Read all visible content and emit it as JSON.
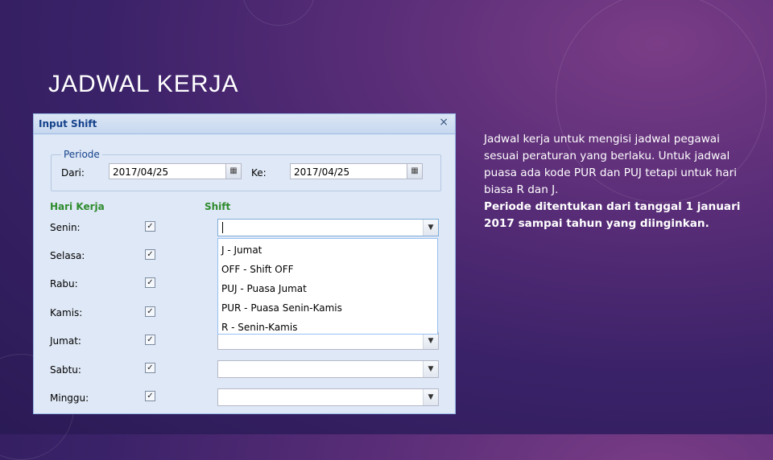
{
  "slide": {
    "title": "JADWAL KERJA",
    "description": "Jadwal kerja untuk mengisi jadwal pegawai sesuai peraturan yang berlaku. Untuk jadwal puasa ada kode PUR dan PUJ tetapi untuk hari biasa R dan J.",
    "note": "Periode ditentukan dari tanggal 1 januari 2017 sampai tahun yang diinginkan."
  },
  "dialog": {
    "title": "Input Shift",
    "close_icon": "×",
    "periode": {
      "legend": "Periode",
      "dari_label": "Dari:",
      "dari_value": "2017/04/25",
      "ke_label": "Ke:",
      "ke_value": "2017/04/25",
      "calendar_icon": "▦"
    },
    "hari_kerja_header": "Hari Kerja",
    "shift_header": "Shift",
    "check_mark": "✓",
    "dropdown_arrow": "▼",
    "days": [
      {
        "label": "Senin:"
      },
      {
        "label": "Selasa:"
      },
      {
        "label": "Rabu:"
      },
      {
        "label": "Kamis:"
      },
      {
        "label": "Jumat:"
      },
      {
        "label": "Sabtu:"
      },
      {
        "label": "Minggu:"
      }
    ],
    "shift_options": [
      "J - Jumat",
      "OFF - Shift OFF",
      "PUJ - Puasa Jumat",
      "PUR - Puasa Senin-Kamis",
      "R - Senin-Kamis"
    ]
  }
}
